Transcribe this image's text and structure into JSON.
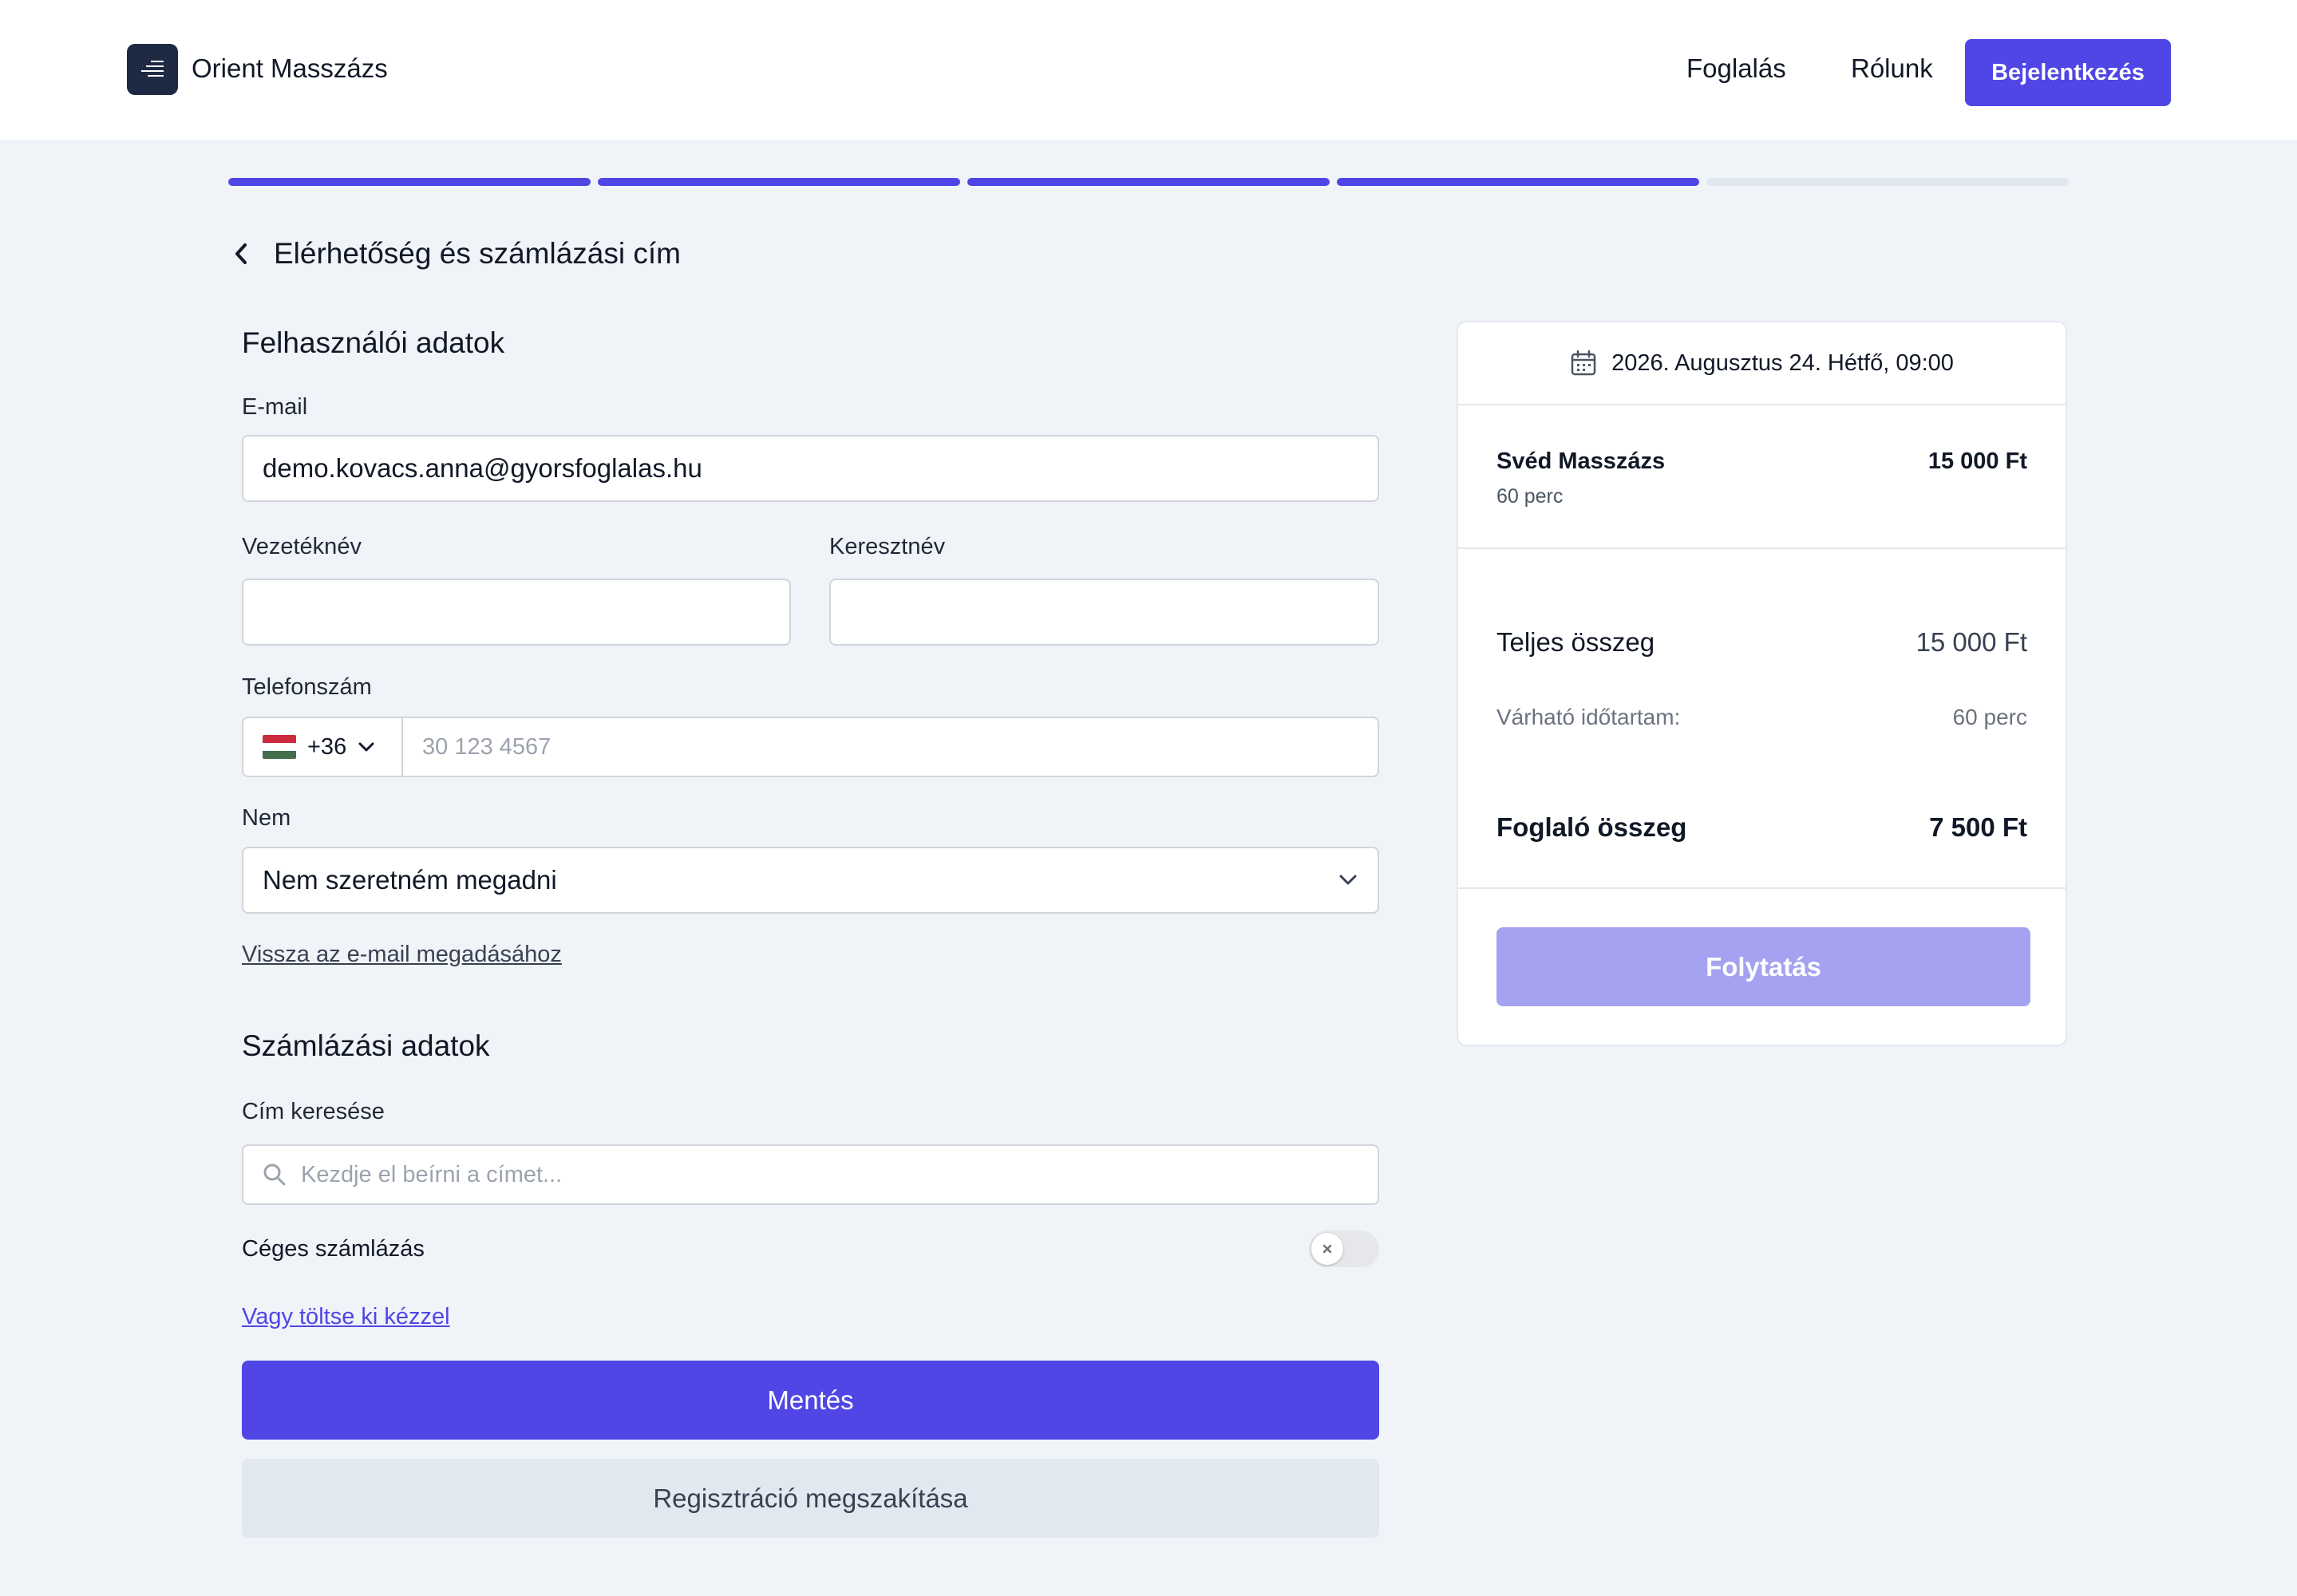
{
  "header": {
    "brand": "Orient Masszázs",
    "nav": {
      "booking": "Foglalás",
      "about": "Rólunk"
    },
    "login_label": "Bejelentkezés"
  },
  "progress": {
    "total_steps": 5,
    "completed_steps": 4
  },
  "page": {
    "title": "Elérhetőség és számlázási cím"
  },
  "user_section": {
    "title": "Felhasználói adatok",
    "email_label": "E-mail",
    "email_value": "demo.kovacs.anna@gyorsfoglalas.hu",
    "last_name_label": "Vezetéknév",
    "last_name_value": "",
    "first_name_label": "Keresztnév",
    "first_name_value": "",
    "phone_label": "Telefonszám",
    "phone_country_code": "+36",
    "phone_placeholder": "30 123 4567",
    "gender_label": "Nem",
    "gender_value": "Nem szeretném megadni",
    "back_to_email_link": "Vissza az e-mail megadásához"
  },
  "billing_section": {
    "title": "Számlázási adatok",
    "address_search_label": "Cím keresése",
    "address_search_placeholder": "Kezdje el beírni a címet...",
    "company_billing_label": "Céges számlázás",
    "company_billing_enabled": false,
    "manual_fill_link": "Vagy töltse ki kézzel"
  },
  "actions": {
    "save_label": "Mentés",
    "cancel_label": "Regisztráció megszakítása"
  },
  "summary": {
    "date": "2026. Augusztus 24. Hétfő, 09:00",
    "service_name": "Svéd Masszázs",
    "service_duration": "60 perc",
    "service_price": "15 000 Ft",
    "total_label": "Teljes összeg",
    "total_value": "15 000 Ft",
    "duration_label": "Várható időtartam:",
    "duration_value": "60 perc",
    "deposit_label": "Foglaló összeg",
    "deposit_value": "7 500 Ft",
    "continue_label": "Folytatás"
  },
  "colors": {
    "accent": "#4f46e5",
    "accent_disabled": "#a5a2f2",
    "background": "#f0f3f8",
    "logo_bg": "#1e2a44",
    "link_muted": "#374151"
  },
  "icons": {
    "logo": "lines-logo-icon",
    "back": "chevron-left-icon",
    "phone_dropdown": "chevron-down-icon",
    "gender_dropdown": "chevron-down-icon",
    "search": "search-icon",
    "toggle_off": "x-icon",
    "date": "calendar-icon",
    "flag": "hungary-flag-icon"
  }
}
